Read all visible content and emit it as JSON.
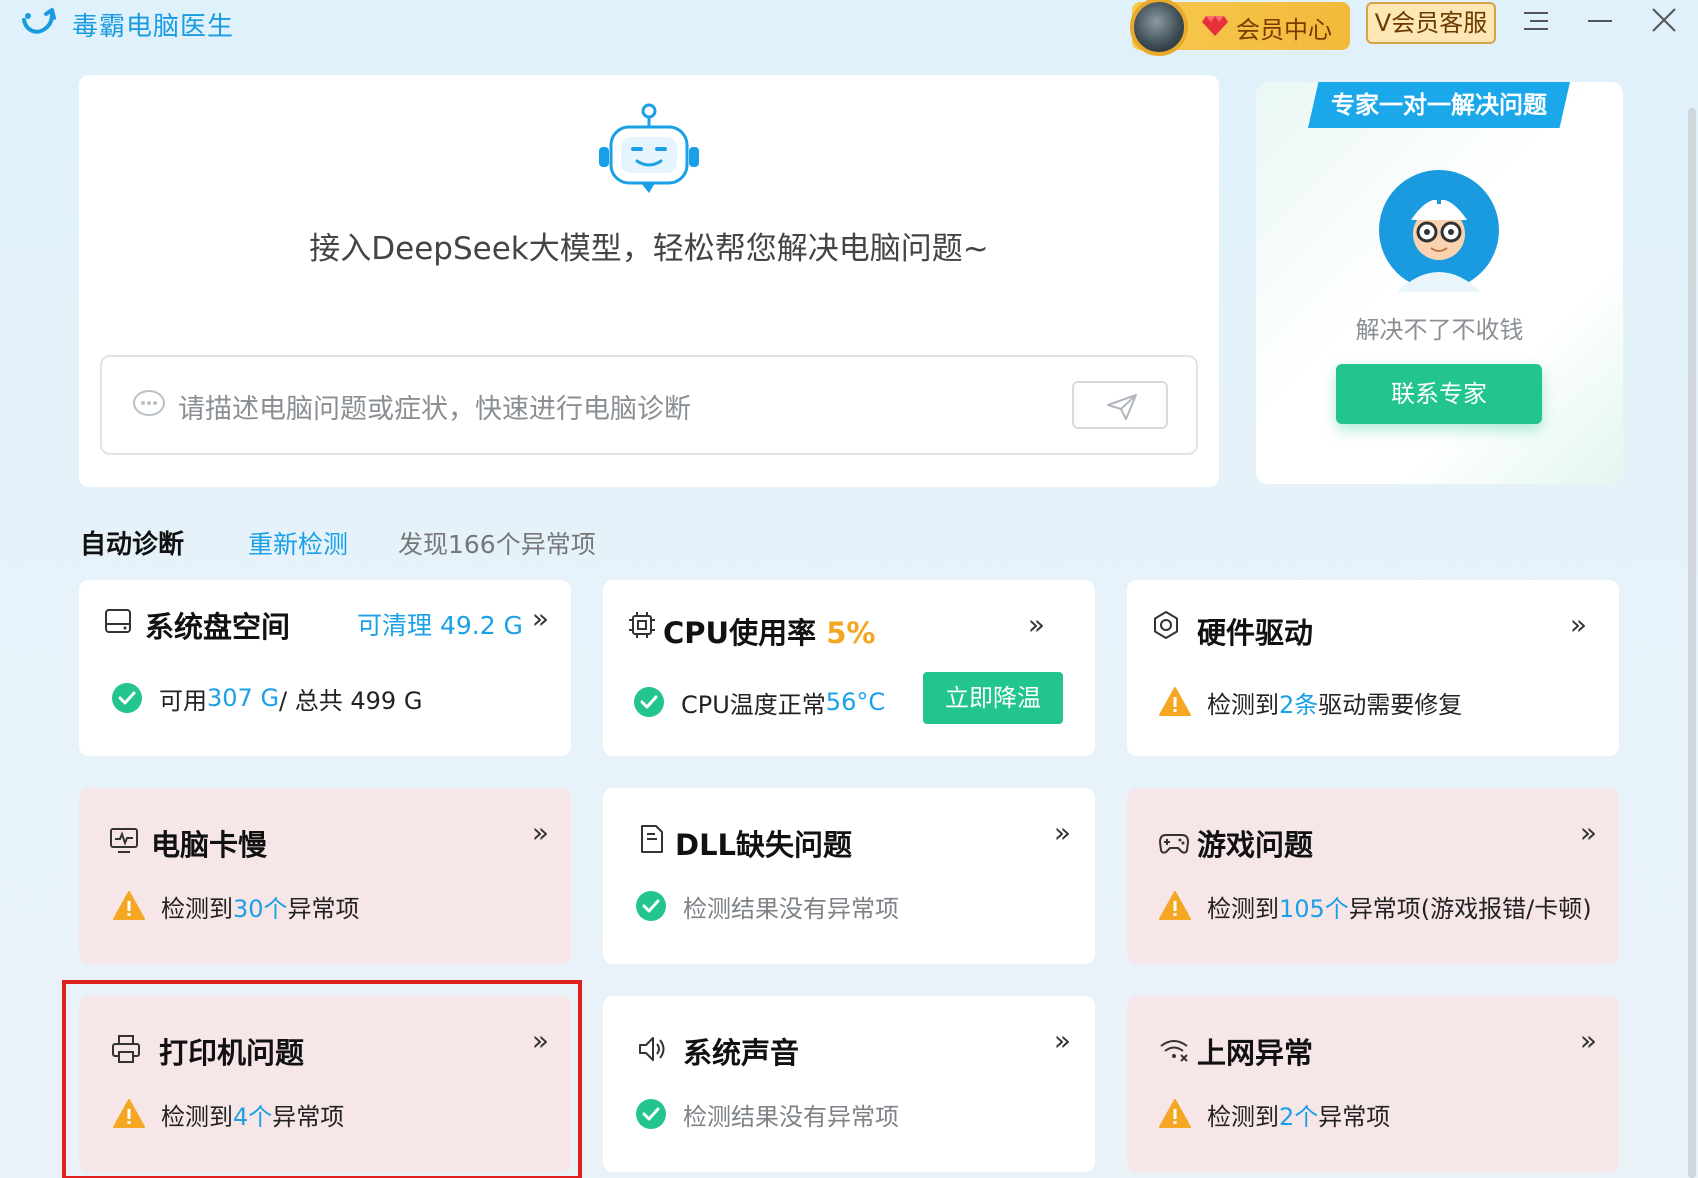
{
  "app": {
    "title": "毒霸电脑医生",
    "vip_label": "会员中心",
    "vip_service": "V会员客服",
    "menu_icon": "menu-icon",
    "minimize_icon": "minimize-icon",
    "close_icon": "close-icon"
  },
  "ai": {
    "headline": "接入DeepSeek大模型，轻松帮您解决电脑问题~",
    "placeholder": "请描述电脑问题或症状，快速进行电脑诊断"
  },
  "expert": {
    "ribbon": "专家一对一解决问题",
    "note": "解决不了不收钱",
    "button": "联系专家"
  },
  "section": {
    "title": "自动诊断",
    "recheck": "重新检测",
    "found": "发现166个异常项"
  },
  "cards": {
    "disk": {
      "title": "系统盘空间",
      "extra": "可清理 49.2 G",
      "s1": "可用 ",
      "s2": "307 G",
      "s3": " / 总共 499 G"
    },
    "cpu": {
      "title": "CPU使用率 ",
      "usage": "5%",
      "s1": "CPU温度正常 ",
      "s2": "56°C",
      "button": "立即降温"
    },
    "driver": {
      "title": "硬件驱动",
      "s1": "检测到 ",
      "s2": "2条",
      "s3": " 驱动需要修复"
    },
    "slow": {
      "title": "电脑卡慢",
      "s1": "检测到 ",
      "s2": "30个",
      "s3": " 异常项"
    },
    "dll": {
      "title": "DLL缺失问题",
      "s1": "检测结果没有异常项"
    },
    "game": {
      "title": "游戏问题",
      "s1": "检测到 ",
      "s2": "105个",
      "s3": " 异常项(游戏报错/卡顿)"
    },
    "printer": {
      "title": "打印机问题",
      "s1": "检测到 ",
      "s2": "4个",
      "s3": " 异常项"
    },
    "sound": {
      "title": "系统声音",
      "s1": "检测结果没有异常项"
    },
    "net": {
      "title": "上网异常",
      "s1": "检测到 ",
      "s2": "2个",
      "s3": " 异常项"
    }
  },
  "colors": {
    "accent": "#1aa0e6",
    "green": "#22c58e",
    "warning": "#f5a623",
    "warn_card": "#f7e6e8",
    "highlight": "#e02020"
  }
}
